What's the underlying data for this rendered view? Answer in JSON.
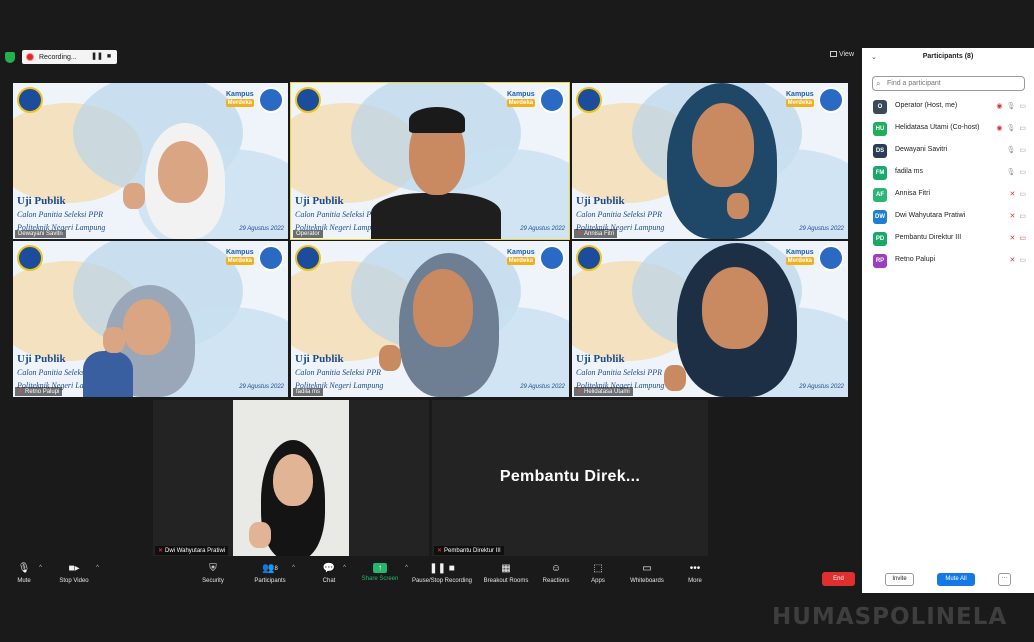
{
  "topbar": {
    "recording_label": "Recording...",
    "pause_symbol": "❚❚",
    "stop_symbol": "■",
    "view_label": "View"
  },
  "backdrop": {
    "title": "Uji Publik",
    "subtitle": "Calon Panitia Seleksi PPR",
    "line3": "Politeknik Negeri Lampung",
    "brand": "Kampus",
    "brand2": "Merdeka",
    "date": "29 Agustus 2022"
  },
  "tiles": [
    {
      "name": "Dewayani Savitri",
      "muted": false
    },
    {
      "name": "Operator",
      "muted": false
    },
    {
      "name": "Annisa Fitri",
      "muted": true
    },
    {
      "name": "Retno Palupi",
      "muted": true
    },
    {
      "name": "fadila ms",
      "muted": false
    },
    {
      "name": "Helidatasa Utami",
      "muted": false
    },
    {
      "name": "Dwi Wahyutara Pratiwi",
      "muted": true
    },
    {
      "name": "Pembantu Direktur III",
      "muted": true
    }
  ],
  "big_name_tile": "Pembantu  Direk...",
  "toolbar": {
    "mute": "Mute",
    "stop_video": "Stop Video",
    "security": "Security",
    "participants": "Participants",
    "participant_count": "8",
    "chat": "Chat",
    "share_screen": "Share Screen",
    "pause_recording": "Pause/Stop Recording",
    "breakout": "Breakout Rooms",
    "reactions": "Reactions",
    "apps": "Apps",
    "whiteboards": "Whiteboards",
    "more": "More",
    "end": "End"
  },
  "panel": {
    "title": "Participants (8)",
    "search_placeholder": "Find a participant",
    "participants": [
      {
        "initials": "O",
        "name": "Operator (Host, me)",
        "color": "#3a4a5a"
      },
      {
        "initials": "HU",
        "name": "Helidatasa Utami (Co-host)",
        "color": "#1fae5b"
      },
      {
        "initials": "DS",
        "name": "Dewayani Savitri",
        "color": "#2c3e55"
      },
      {
        "initials": "FM",
        "name": "fadila ms",
        "color": "#1aa86a"
      },
      {
        "initials": "AF",
        "name": "Annisa Fitri",
        "color": "#2bb673"
      },
      {
        "initials": "DW",
        "name": "Dwi Wahyutara Pratiwi",
        "color": "#1e7fd1"
      },
      {
        "initials": "PD",
        "name": "Pembantu Direktur III",
        "color": "#1aa86a"
      },
      {
        "initials": "RP",
        "name": "Retno Palupi",
        "color": "#9b3fc0"
      }
    ],
    "invite": "Invite",
    "mute_all": "Mute All",
    "more": "···"
  },
  "watermark": "HUMASPOLINELA",
  "colors": {
    "accent_blue": "#1479e6",
    "end_red": "#e02f2f",
    "share_green": "#2ab56f"
  }
}
